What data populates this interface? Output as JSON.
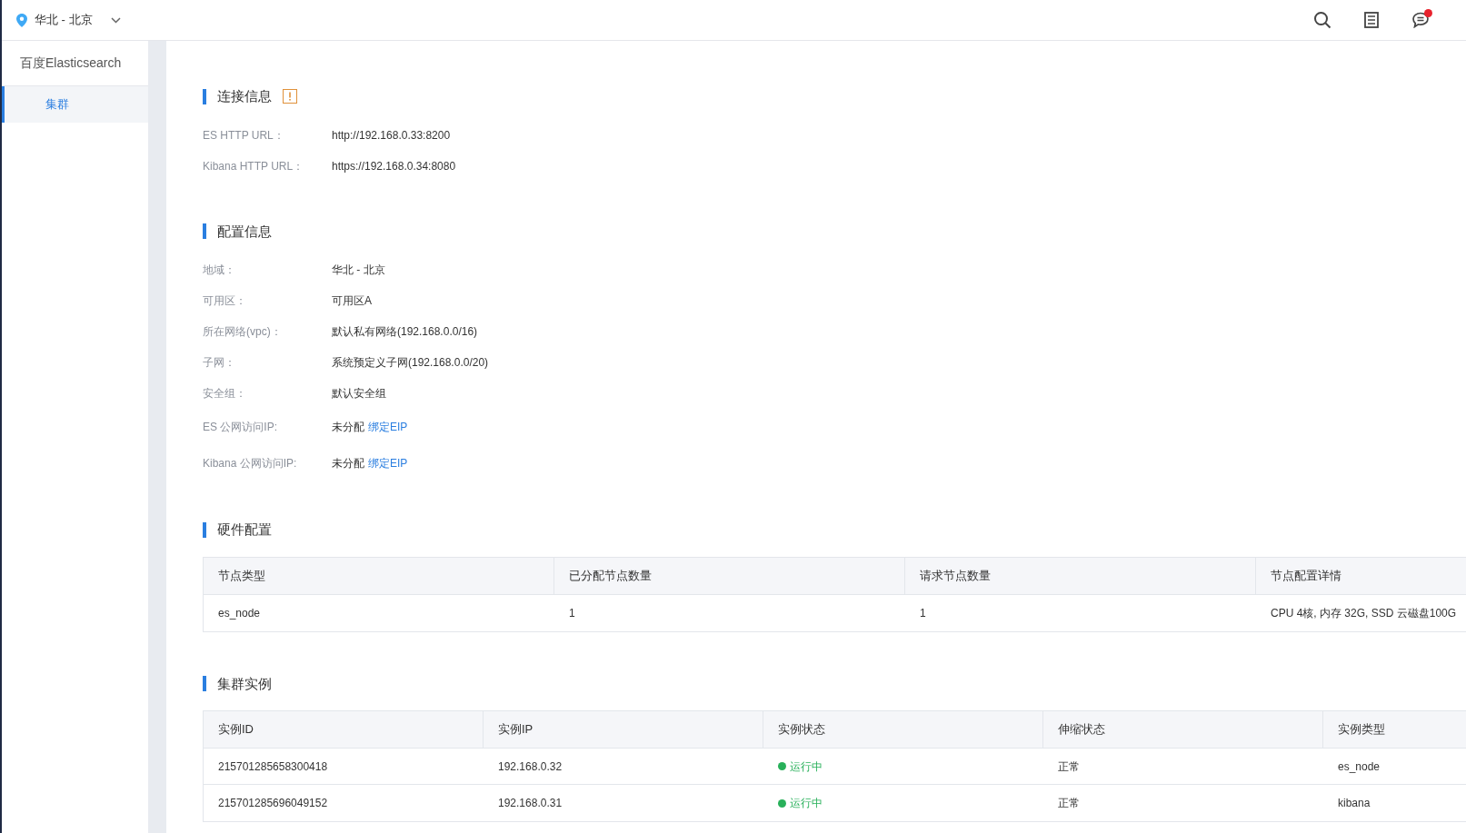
{
  "header": {
    "region": "华北 - 北京",
    "notification_badge": true
  },
  "sidebar": {
    "title": "百度Elasticsearch",
    "items": [
      {
        "label": "集群",
        "selected": true
      }
    ]
  },
  "connection": {
    "title": "连接信息",
    "rows": [
      {
        "label": "ES HTTP URL：",
        "value": "http://192.168.0.33:8200"
      },
      {
        "label": "Kibana HTTP URL：",
        "value": "https://192.168.0.34:8080"
      }
    ]
  },
  "config": {
    "title": "配置信息",
    "rows": [
      {
        "label": "地域：",
        "value": "华北 - 北京"
      },
      {
        "label": "可用区：",
        "value": "可用区A"
      },
      {
        "label": "所在网络(vpc)：",
        "value": "默认私有网络(192.168.0.0/16)"
      },
      {
        "label": "子网：",
        "value": "系统预定义子网(192.168.0.0/20)"
      },
      {
        "label": "安全组：",
        "value": "默认安全组"
      },
      {
        "label": "ES 公网访问IP:",
        "value": "未分配",
        "link": "绑定EIP"
      },
      {
        "label": "Kibana 公网访问IP:",
        "value": "未分配",
        "link": "绑定EIP"
      }
    ]
  },
  "hardware": {
    "title": "硬件配置",
    "columns": [
      "节点类型",
      "已分配节点数量",
      "请求节点数量",
      "节点配置详情"
    ],
    "rows": [
      [
        "es_node",
        "1",
        "1",
        "CPU 4核, 内存 32G, SSD 云磁盘100G"
      ]
    ]
  },
  "instances": {
    "title": "集群实例",
    "columns": [
      "实例ID",
      "实例IP",
      "实例状态",
      "伸缩状态",
      "实例类型"
    ],
    "rows": [
      {
        "id": "215701285658300418",
        "ip": "192.168.0.32",
        "status": {
          "text": "运行中",
          "color": "#28b05a"
        },
        "scaling": "正常",
        "type": "es_node"
      },
      {
        "id": "215701285696049152",
        "ip": "192.168.0.31",
        "status": {
          "text": "运行中",
          "color": "#28b05a"
        },
        "scaling": "正常",
        "type": "kibana"
      }
    ]
  }
}
